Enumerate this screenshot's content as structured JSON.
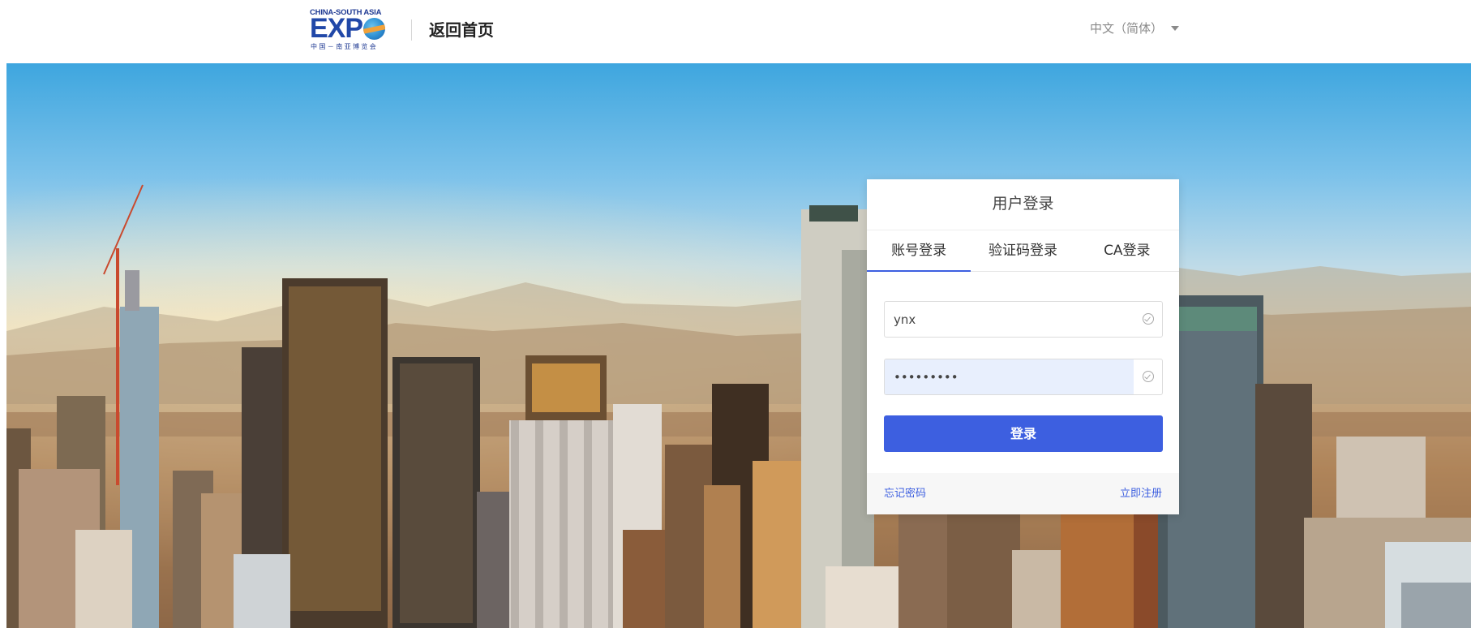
{
  "header": {
    "logo": {
      "top_text": "CHINA-SOUTH ASIA",
      "main_text": "EXP",
      "bottom_text": "中国－南亚博览会"
    },
    "back_home_label": "返回首页",
    "language": {
      "selected": "中文（简体）",
      "icon": "caret-down-icon"
    }
  },
  "login": {
    "title": "用户登录",
    "tabs": [
      {
        "label": "账号登录",
        "active": true
      },
      {
        "label": "验证码登录",
        "active": false
      },
      {
        "label": "CA登录",
        "active": false
      }
    ],
    "username": {
      "value": "ynx",
      "icon": "check-circle-icon"
    },
    "password": {
      "value": "•••••••••",
      "icon": "check-circle-icon"
    },
    "submit_label": "登录",
    "forgot_password_label": "忘记密码",
    "register_label": "立即注册"
  },
  "colors": {
    "accent": "#3d5fe0",
    "logo_blue": "#2148a8",
    "autofill_bg": "#e8effd"
  }
}
